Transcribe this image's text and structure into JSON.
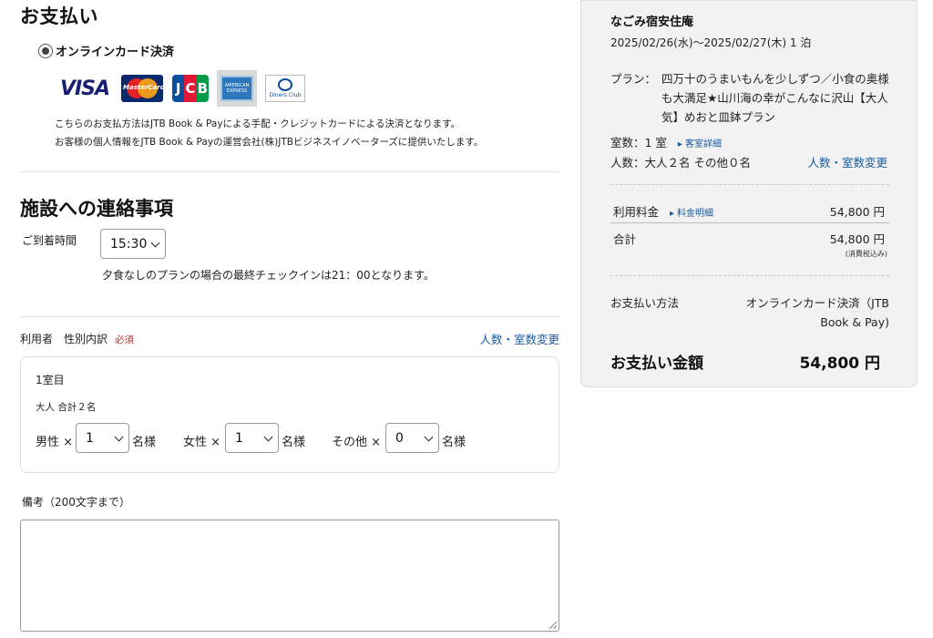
{
  "payment": {
    "heading": "お支払い",
    "option_label": "オンラインカード決済",
    "cards": {
      "visa": "VISA",
      "mastercard": "MasterCard",
      "jcb": [
        "J",
        "C",
        "B"
      ],
      "amex_line1": "AMERICAN",
      "amex_line2": "EXPRESS",
      "diners": "Diners Club"
    },
    "note1": "こちらのお支払方法はJTB Book & Payによる手配・クレジットカードによる決済となります。",
    "note2": "お客様の個人情報をJTB Book & Payの運営会社(株)JTBビジネスイノベーターズに提供いたします。"
  },
  "contact": {
    "heading": "施設への連絡事項",
    "arrival_label": "ご到着時間",
    "arrival_time": "15:30",
    "checkin_note": "夕食なしのプランの場合の最終チェックインは21：00となります。"
  },
  "guests": {
    "label": "利用者　性別内訳",
    "required": "必須",
    "change_link": "人数・室数変更",
    "room_title": "1室目",
    "adults_total": "大人 合計２名",
    "male_label": "男性 ×",
    "male_value": "1",
    "female_label": "女性 ×",
    "female_value": "1",
    "other_label": "その他 ×",
    "other_value": "0",
    "suffix": "名様"
  },
  "remarks": {
    "label": "備考（200文字まで）",
    "value": ""
  },
  "summary": {
    "hotel_name": "なごみ宿安住庵",
    "dates": "2025/02/26(水)〜2025/02/27(木) 1 泊",
    "plan_label": "プラン：",
    "plan_name": "四万十のうまいもんを少しずつ／小食の奥様も大満足★山川海の幸がこんなに沢山【大人気】めおと皿鉢プラン",
    "rooms": "室数：1 室",
    "room_detail_link": "客室詳細",
    "people": "人数：大人２名 その他０名",
    "people_change_link": "人数・室数変更",
    "fee_label": "利用料金",
    "fee_detail_link": "料金明細",
    "fee_value": "54,800 円",
    "total_label": "合計",
    "total_value": "54,800 円",
    "tax_note": "(消費税込み)",
    "payment_method_label": "お支払い方法",
    "payment_method_value": "オンラインカード決済（JTB Book & Pay)",
    "amount_label": "お支払い金額",
    "amount_value": "54,800 円"
  },
  "colors": {
    "link": "#1a5aa0",
    "required": "#d0271d",
    "summary_bg": "#f2f2f2"
  }
}
